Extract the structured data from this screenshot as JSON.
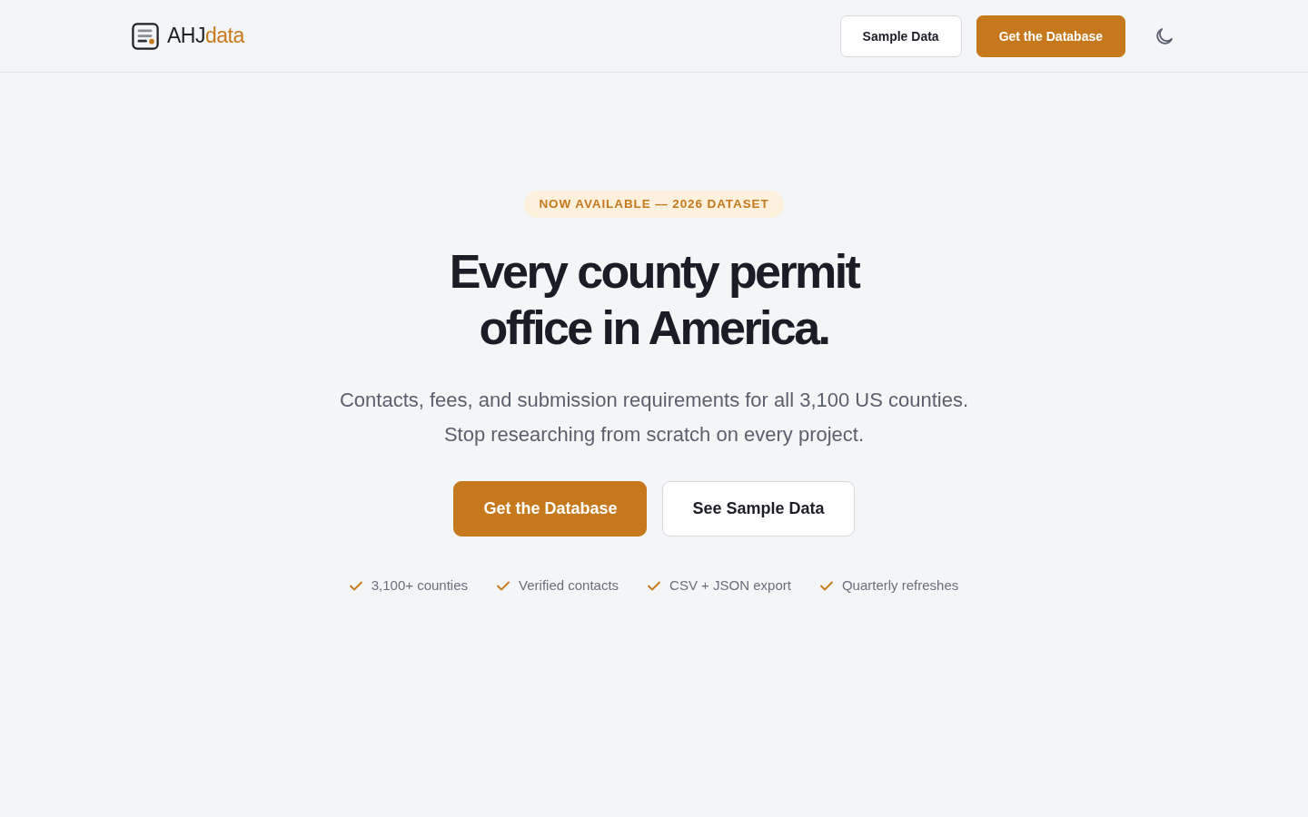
{
  "header": {
    "logo": {
      "primary": "AHJ",
      "accent": "data"
    },
    "buttons": [
      {
        "label": "Sample Data",
        "kind": "secondary"
      },
      {
        "label": "Get the Database",
        "kind": "primary"
      }
    ]
  },
  "hero": {
    "badge": "NOW AVAILABLE — 2026 DATASET",
    "headline": [
      "Every county permit",
      "office in America."
    ],
    "subtitle": [
      "Contacts, fees, and submission requirements for all 3,100 US counties.",
      "Stop researching from scratch on every project."
    ],
    "buttons": [
      {
        "label": "Get the Database",
        "kind": "primary"
      },
      {
        "label": "See Sample Data",
        "kind": "secondary"
      }
    ],
    "features": [
      "3,100+ counties",
      "Verified contacts",
      "CSV + JSON export",
      "Quarterly refreshes"
    ]
  }
}
